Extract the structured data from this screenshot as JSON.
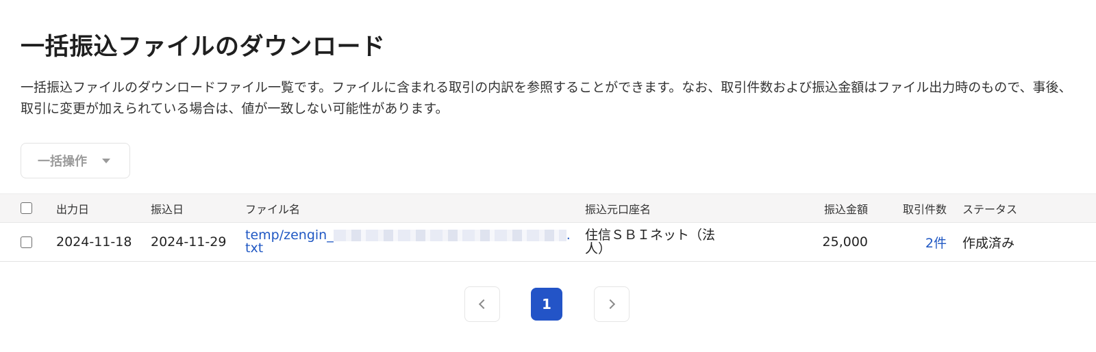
{
  "page": {
    "title": "一括振込ファイルのダウンロード",
    "description": "一括振込ファイルのダウンロードファイル一覧です。ファイルに含まれる取引の内訳を参照することができます。なお、取引件数および振込金額はファイル出力時のもので、事後、取引に変更が加えられている場合は、値が一致しない可能性があります。"
  },
  "bulk_action": {
    "label": "一括操作"
  },
  "table": {
    "headers": {
      "output_date": "出力日",
      "transfer_date": "振込日",
      "file_name": "ファイル名",
      "source_account": "振込元口座名",
      "amount": "振込金額",
      "count": "取引件数",
      "status": "ステータス"
    },
    "rows": [
      {
        "output_date": "2024-11-18",
        "transfer_date": "2024-11-29",
        "file_name_prefix": "temp/zengin_",
        "file_name_suffix": ".txt",
        "source_account": "住信ＳＢＩネット（法人）",
        "amount": "25,000",
        "count": "2件",
        "status": "作成済み"
      }
    ]
  },
  "pagination": {
    "current_page": "1",
    "prev_icon": "chevron-left-icon",
    "next_icon": "chevron-right-icon"
  }
}
